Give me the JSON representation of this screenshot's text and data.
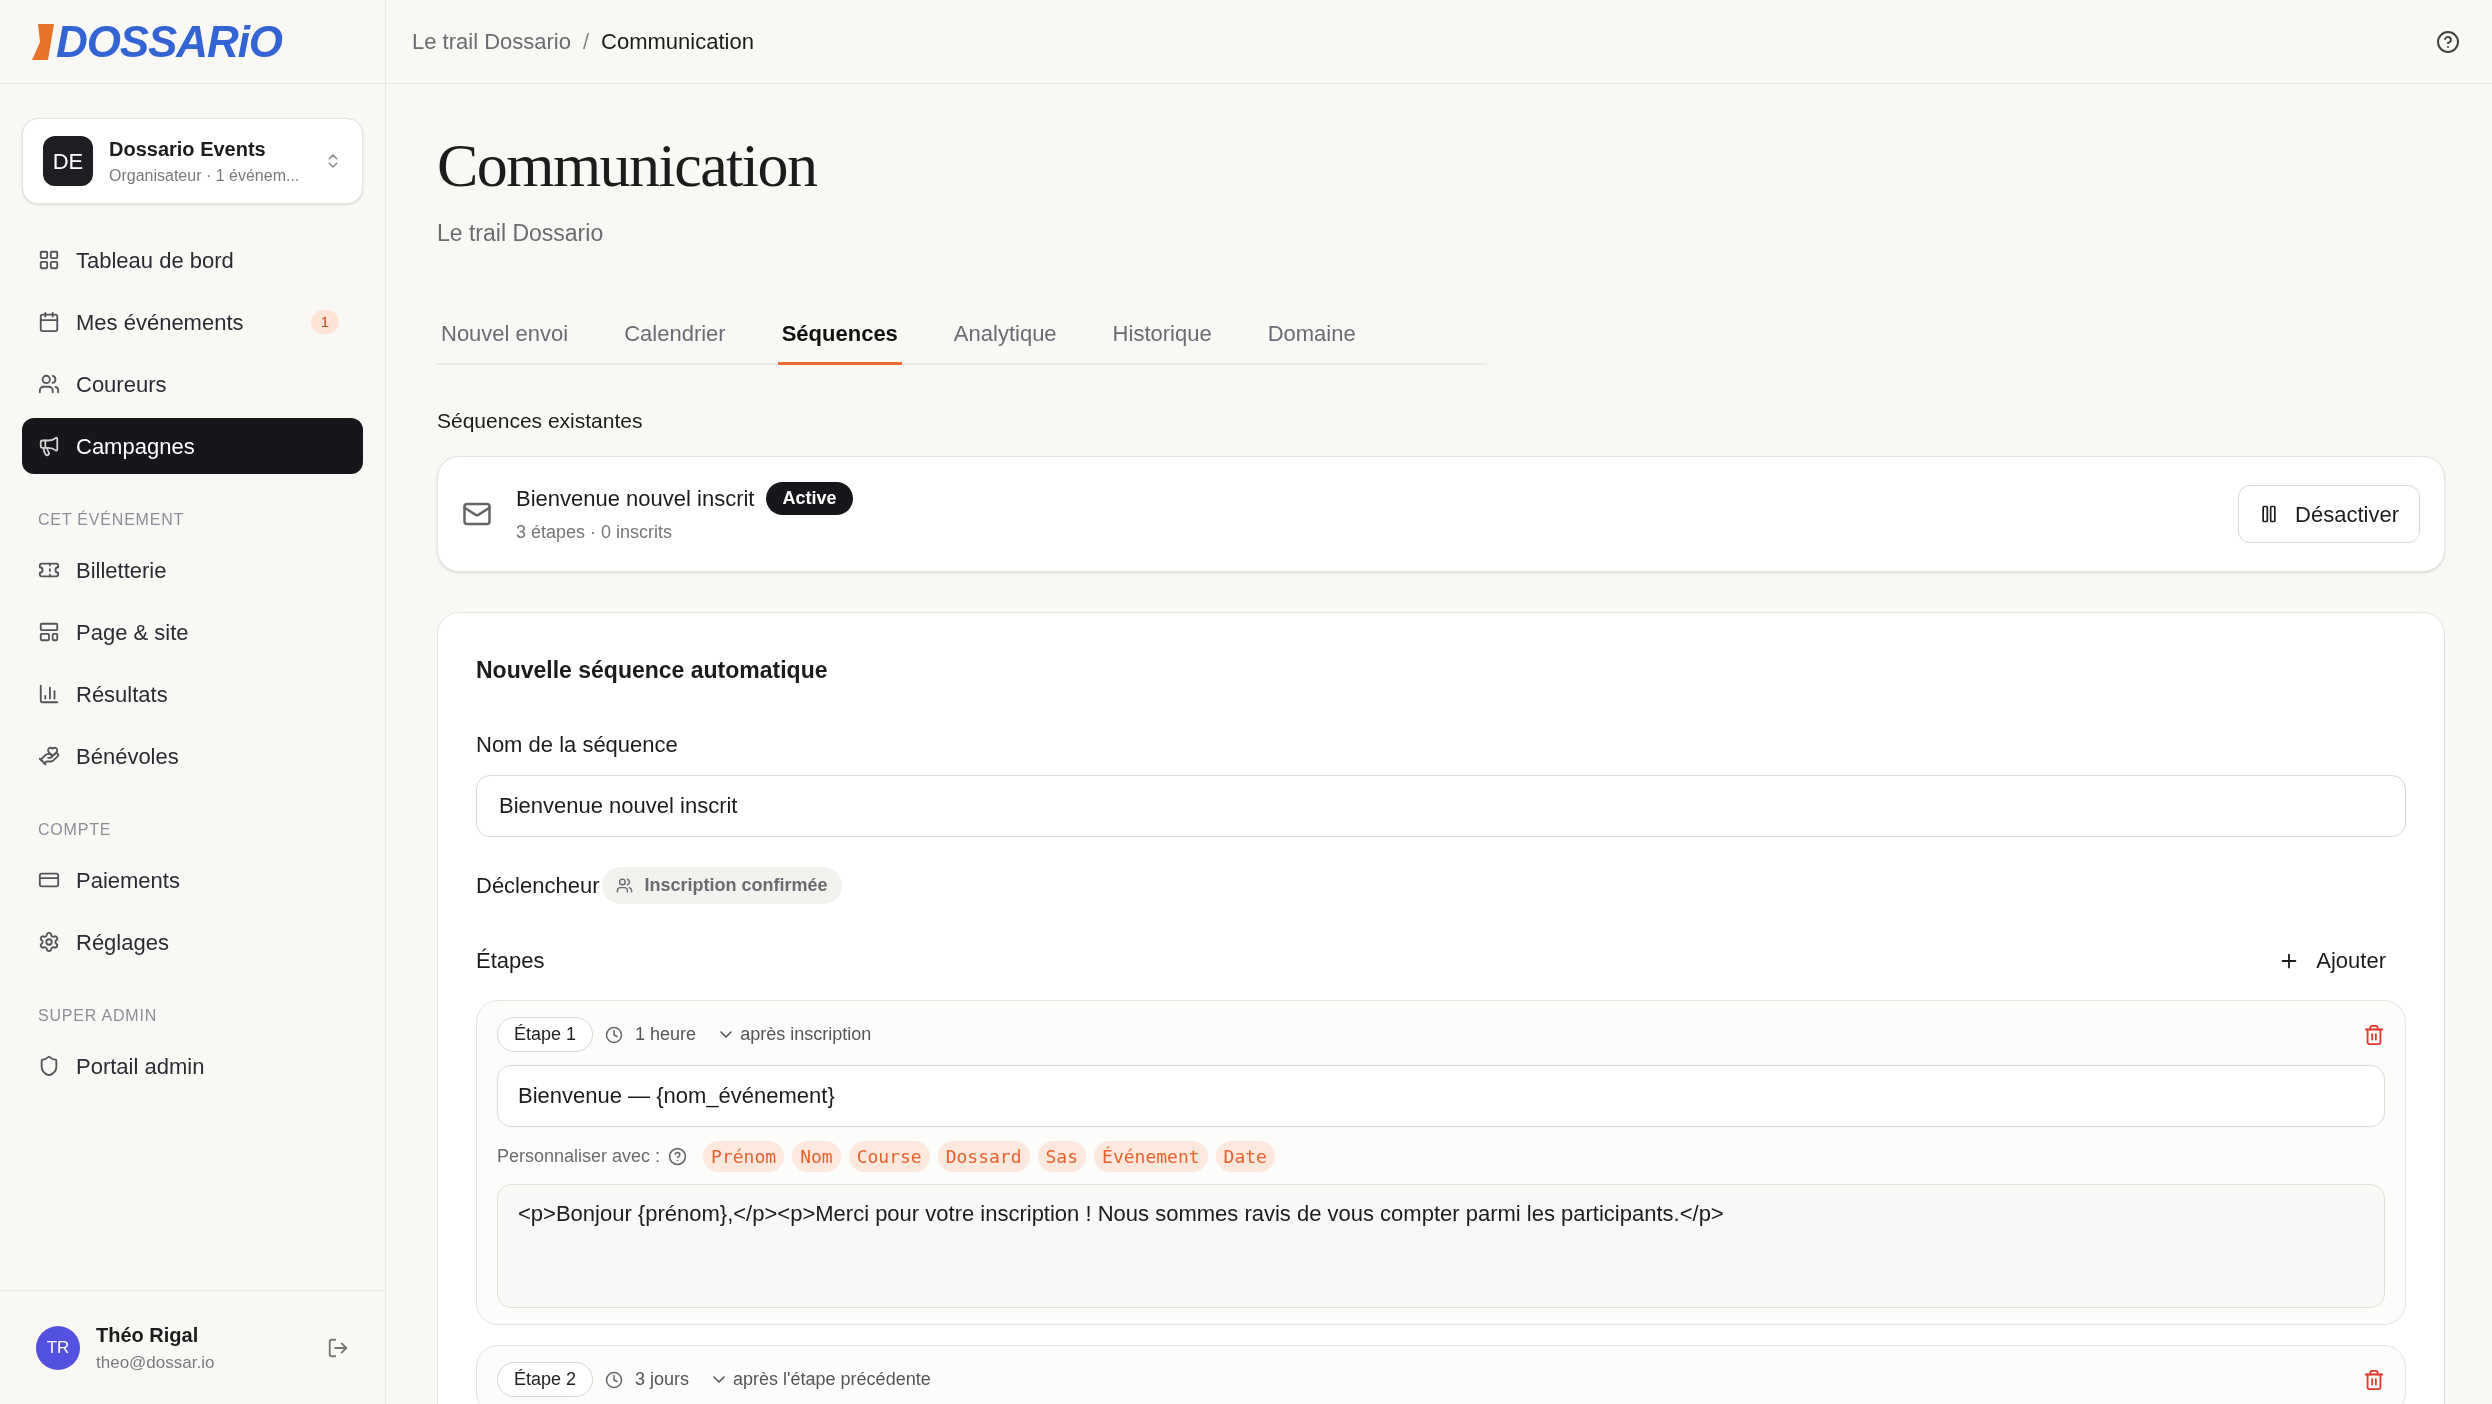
{
  "logo": "DOSSARiO",
  "org": {
    "initials": "DE",
    "name": "Dossario Events",
    "subtitle": "Organisateur · 1 événem..."
  },
  "nav_sections": [
    {
      "items": [
        {
          "label": "Tableau de bord",
          "selected": false
        },
        {
          "label": "Mes événements",
          "selected": false,
          "badge": "1"
        },
        {
          "label": "Coureurs",
          "selected": false
        },
        {
          "label": "Campagnes",
          "selected": true
        }
      ]
    },
    {
      "heading": "CET ÉVÉNEMENT",
      "items": [
        {
          "label": "Billetterie",
          "selected": false
        },
        {
          "label": "Page & site",
          "selected": false
        },
        {
          "label": "Résultats",
          "selected": false
        },
        {
          "label": "Bénévoles",
          "selected": false
        }
      ]
    },
    {
      "heading": "COMPTE",
      "items": [
        {
          "label": "Paiements",
          "selected": false
        },
        {
          "label": "Réglages",
          "selected": false
        }
      ]
    },
    {
      "heading": "SUPER ADMIN",
      "items": [
        {
          "label": "Portail admin",
          "selected": false
        }
      ]
    }
  ],
  "user": {
    "initials": "TR",
    "name": "Théo Rigal",
    "email": "theo@dossar.io"
  },
  "breadcrumb": [
    "Le trail Dossario",
    "Communication"
  ],
  "breadcrumb_separator": "/",
  "page": {
    "title": "Communication",
    "subtitle": "Le trail Dossario"
  },
  "tabs": [
    {
      "label": "Nouvel envoi",
      "selected": false
    },
    {
      "label": "Calendrier",
      "selected": false
    },
    {
      "label": "Séquences",
      "selected": true
    },
    {
      "label": "Analytique",
      "selected": false
    },
    {
      "label": "Historique",
      "selected": false
    },
    {
      "label": "Domaine",
      "selected": false
    }
  ],
  "existing": {
    "heading": "Séquences existantes",
    "sequences": [
      {
        "name": "Bienvenue nouvel inscrit",
        "status": "Active",
        "meta": "3 étapes · 0 inscrits",
        "action": "Désactiver"
      }
    ]
  },
  "new_sequence": {
    "title": "Nouvelle séquence automatique",
    "name_label": "Nom de la séquence",
    "name_value": "Bienvenue nouvel inscrit",
    "trigger_label": "Déclencheur",
    "trigger": "Inscription confirmée",
    "steps_label": "Étapes",
    "add_button": "Ajouter",
    "steps": [
      {
        "label": "Étape 1",
        "delay": "1 heure",
        "anchor": "après inscription",
        "subject": "Bienvenue — {nom_événement}",
        "personalize_label": "Personnaliser avec :",
        "variables": [
          "Prénom",
          "Nom",
          "Course",
          "Dossard",
          "Sas",
          "Événement",
          "Date"
        ],
        "body": "<p>Bonjour {prénom},</p><p>Merci pour votre inscription ! Nous sommes ravis de vous compter parmi les participants.</p>"
      },
      {
        "label": "Étape 2",
        "delay": "3 jours",
        "anchor": "après l'étape précédente"
      }
    ]
  }
}
